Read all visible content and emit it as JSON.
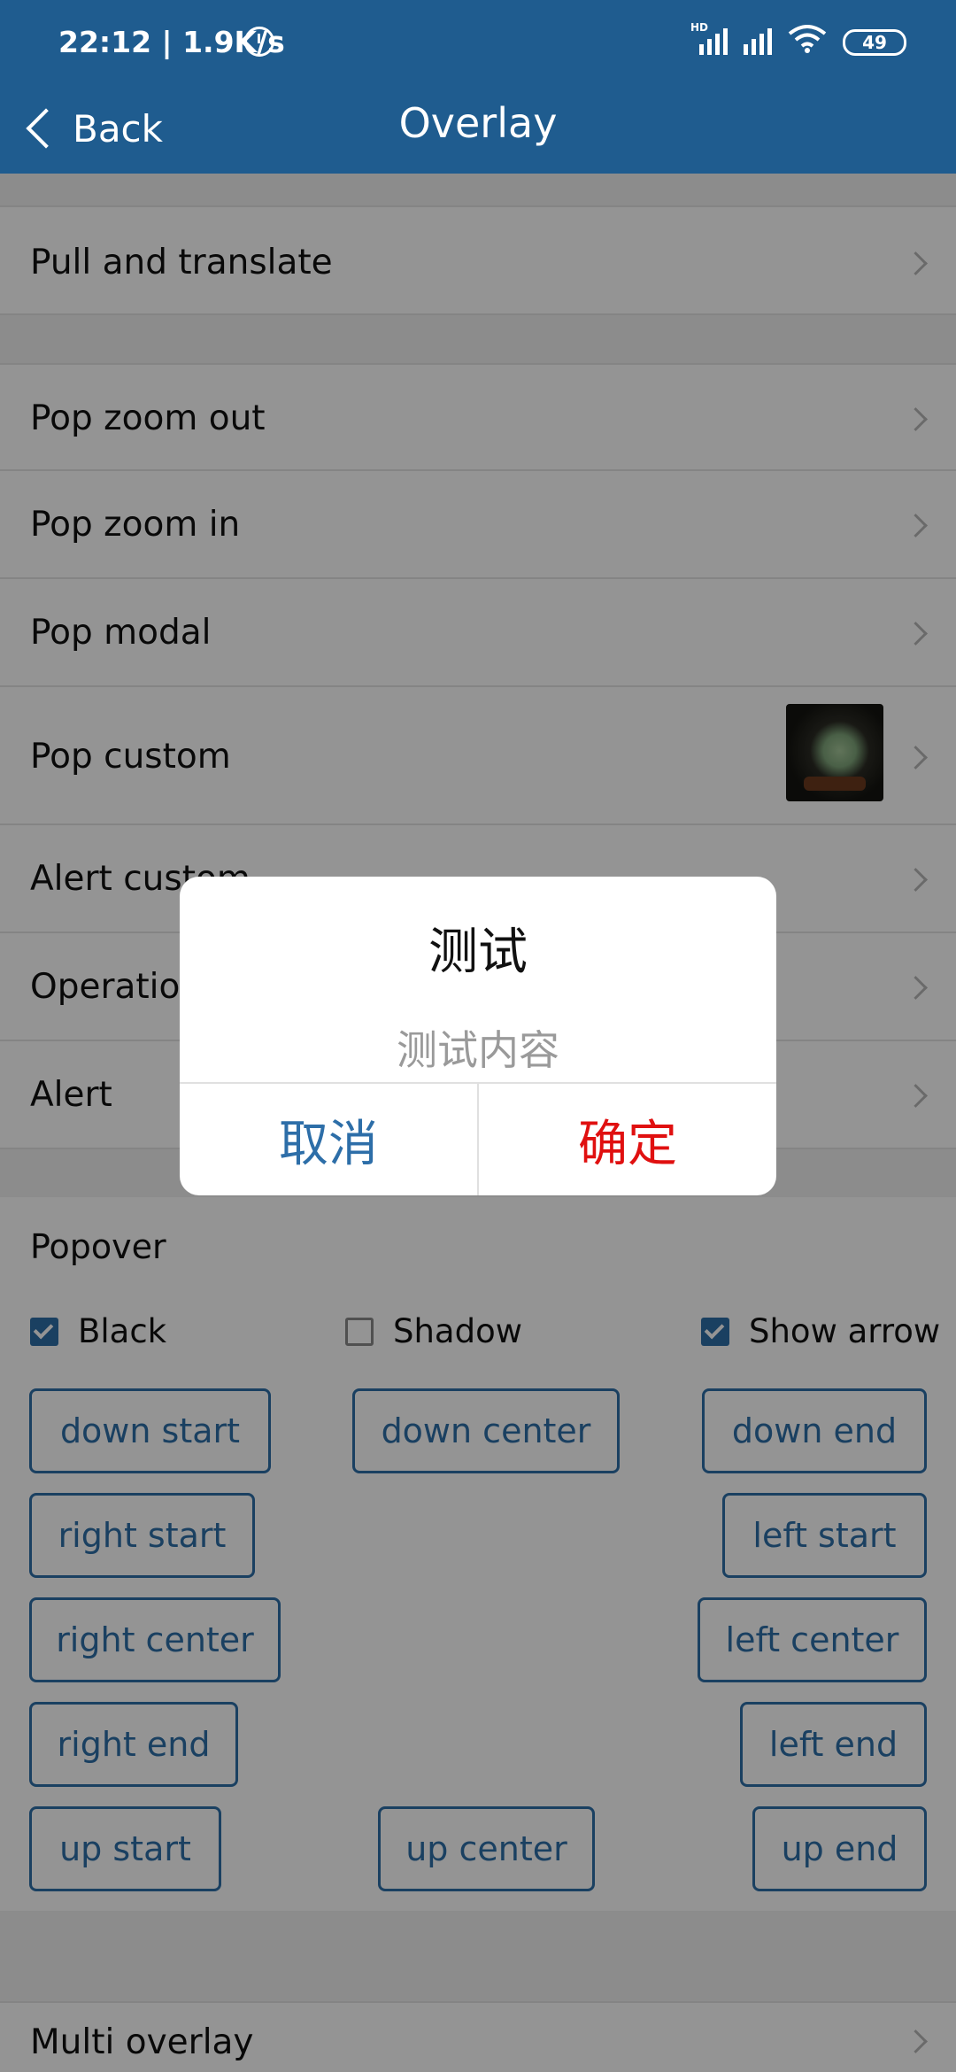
{
  "status_bar": {
    "time": "22:12 | 1.9K/s",
    "network_label": "HD",
    "battery": "49"
  },
  "nav": {
    "back_label": "Back",
    "title": "Overlay"
  },
  "list_top": [
    {
      "label": "Pull and translate"
    }
  ],
  "list_pop": [
    {
      "label": "Pop zoom out"
    },
    {
      "label": "Pop zoom in"
    },
    {
      "label": "Pop modal"
    },
    {
      "label": "Pop custom"
    },
    {
      "label": "Alert custom"
    },
    {
      "label": "Operation"
    },
    {
      "label": "Alert"
    }
  ],
  "popover": {
    "title": "Popover",
    "options": [
      {
        "label": "Black",
        "checked": true
      },
      {
        "label": "Shadow",
        "checked": false
      },
      {
        "label": "Show arrow",
        "checked": true
      }
    ],
    "buttons": {
      "down_start": "down start",
      "down_center": "down center",
      "down_end": "down end",
      "right_start": "right start",
      "left_start": "left start",
      "right_center": "right center",
      "left_center": "left center",
      "right_end": "right end",
      "left_end": "left end",
      "up_start": "up start",
      "up_center": "up center",
      "up_end": "up end"
    }
  },
  "list_bottom": [
    {
      "label": "Multi overlay"
    }
  ],
  "dialog": {
    "title": "测试",
    "message": "测试内容",
    "cancel_label": "取消",
    "confirm_label": "确定"
  },
  "colors": {
    "primary": "#1f5c8f",
    "accent": "#2d6ea8",
    "confirm": "#e01010"
  }
}
